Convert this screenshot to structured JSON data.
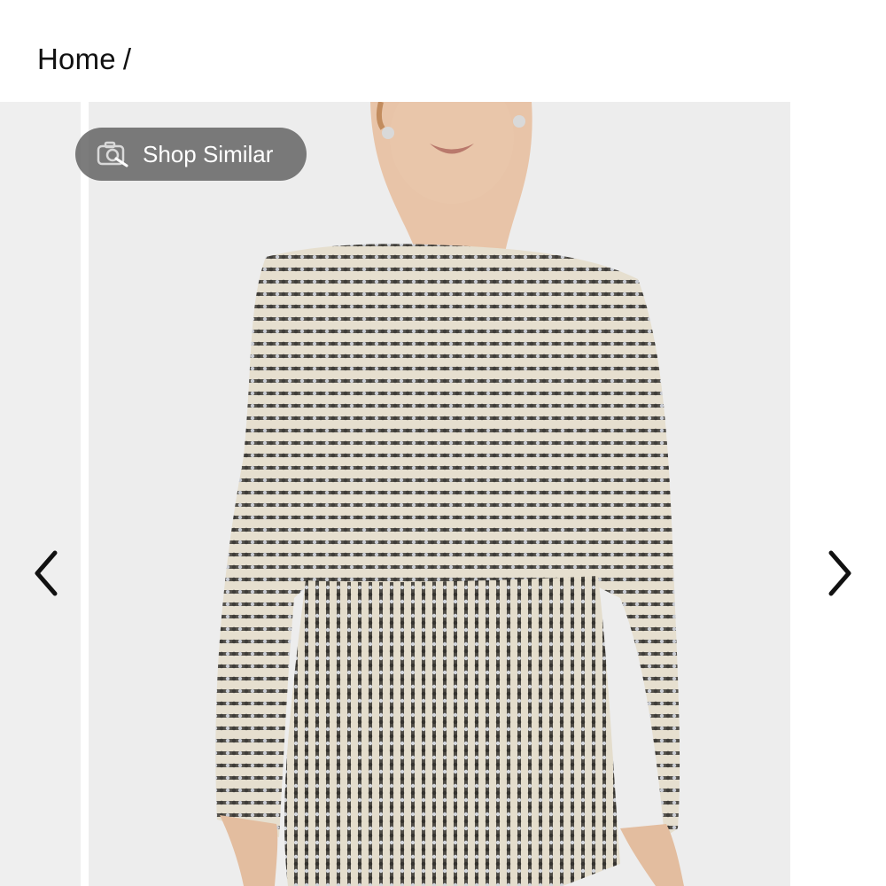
{
  "breadcrumb": {
    "home_label": "Home",
    "separator": "/"
  },
  "gallery": {
    "shop_similar_label": "Shop Similar",
    "main_image_alt": "Sequin romper",
    "prev_icon": "chevron-left-icon",
    "next_icon": "chevron-right-icon"
  },
  "colors": {
    "background": "#ffffff",
    "image_bg": "#ededed",
    "pill_bg": "#5f5f5f",
    "text": "#111111"
  }
}
